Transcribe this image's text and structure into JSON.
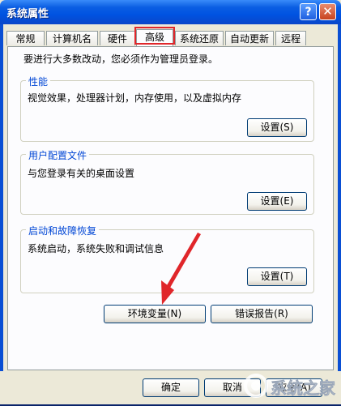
{
  "window": {
    "title": "系统属性",
    "help_glyph": "?",
    "close_glyph": "✕"
  },
  "tabs": [
    {
      "label": "常规"
    },
    {
      "label": "计算机名"
    },
    {
      "label": "硬件"
    },
    {
      "label": "高级"
    },
    {
      "label": "系统还原"
    },
    {
      "label": "自动更新"
    },
    {
      "label": "远程"
    }
  ],
  "active_tab": "高级",
  "admin_note": "要进行大多数改动，您必须作为管理员登录。",
  "groups": {
    "performance": {
      "title": "性能",
      "description": "视觉效果，处理器计划，内存使用，以及虚拟内存",
      "button": "设置(S)"
    },
    "user_profiles": {
      "title": "用户配置文件",
      "description": "与您登录有关的桌面设置",
      "button": "设置(E)"
    },
    "startup_recovery": {
      "title": "启动和故障恢复",
      "description": "系统启动，系统失败和调试信息",
      "button": "设置(T)"
    }
  },
  "env_button": "环境变量(N)",
  "error_report_button": "错误报告(R)",
  "bottom": {
    "ok": "确定",
    "cancel": "取消",
    "apply": "应用(A)"
  },
  "watermark": {
    "text": "系统之家"
  },
  "colors": {
    "title_bar": "#0053e1",
    "group_title": "#0046d5",
    "highlight": "#e0262a",
    "arrow": "#e0262a"
  }
}
